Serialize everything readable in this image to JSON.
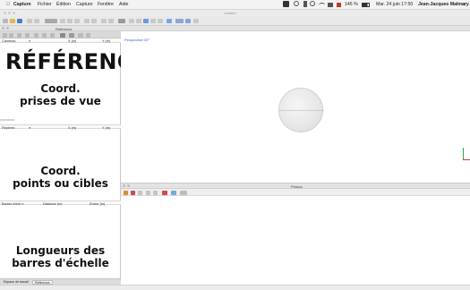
{
  "menubar": {
    "apple": "",
    "app_name": "Capture",
    "items": [
      "Fichier",
      "Édition",
      "Capture",
      "Fenêtre",
      "Aide"
    ],
    "battery": "146 %",
    "clock": "Mar. 24 juin  17:50",
    "user": "Jean-Jacques Malmary"
  },
  "window": {
    "title": "Untitled"
  },
  "references_panel": {
    "header": "Référence",
    "big_title": "RÉFÉRENCES",
    "cameras": {
      "columns": [
        "Caméras",
        "≡",
        "X (m)",
        "Y (m)"
      ],
      "label": "Coord.\nprises de vue"
    },
    "reperes": {
      "columns": [
        "Repères",
        "≡",
        "X (m)",
        "Y (m)"
      ],
      "label": "Coord.\npoints ou cibles"
    },
    "barres": {
      "columns": [
        "Barres d'éch ≡",
        "Distance (m)",
        "Erreur (m)"
      ],
      "label": "Longueurs des\nbarres d'échelle"
    },
    "bottom_tabs": [
      "Espace de travail",
      "Référence"
    ]
  },
  "viewport": {
    "header": "",
    "perspective_label": "Perspective 30°"
  },
  "photos_panel": {
    "header": "Photos"
  }
}
